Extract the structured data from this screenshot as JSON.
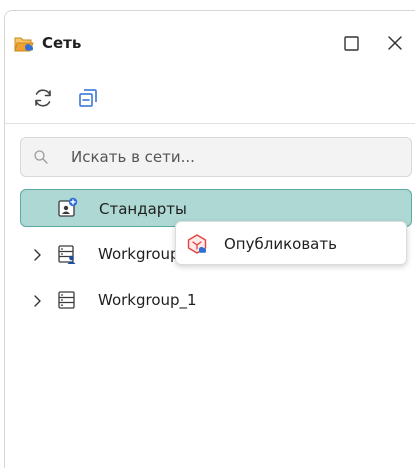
{
  "panel": {
    "title": "Сеть",
    "icons": {
      "header": "network-folder-icon",
      "maximize": "maximize-icon",
      "close": "close-icon"
    }
  },
  "toolbar": {
    "refresh_icon": "refresh-icon",
    "collapse_icon": "collapse-all-icon"
  },
  "search": {
    "placeholder": "Искать в сети...",
    "value": ""
  },
  "tree": {
    "items": [
      {
        "label": "Стандарты",
        "icon": "standards-icon",
        "selected": true,
        "expandable": false
      },
      {
        "label": "Workgroup",
        "icon": "server-user-icon",
        "selected": false,
        "expandable": true
      },
      {
        "label": "Workgroup_1",
        "icon": "server-icon",
        "selected": false,
        "expandable": true
      }
    ]
  },
  "context_menu": {
    "items": [
      {
        "label": "Опубликовать",
        "icon": "publish-icon"
      }
    ]
  },
  "colors": {
    "selection_bg": "#aed8d4",
    "selection_border": "#5aaaa2",
    "accent_blue": "#2f6fd6",
    "folder_orange": "#f0a030",
    "publish_red": "#e0443e"
  }
}
